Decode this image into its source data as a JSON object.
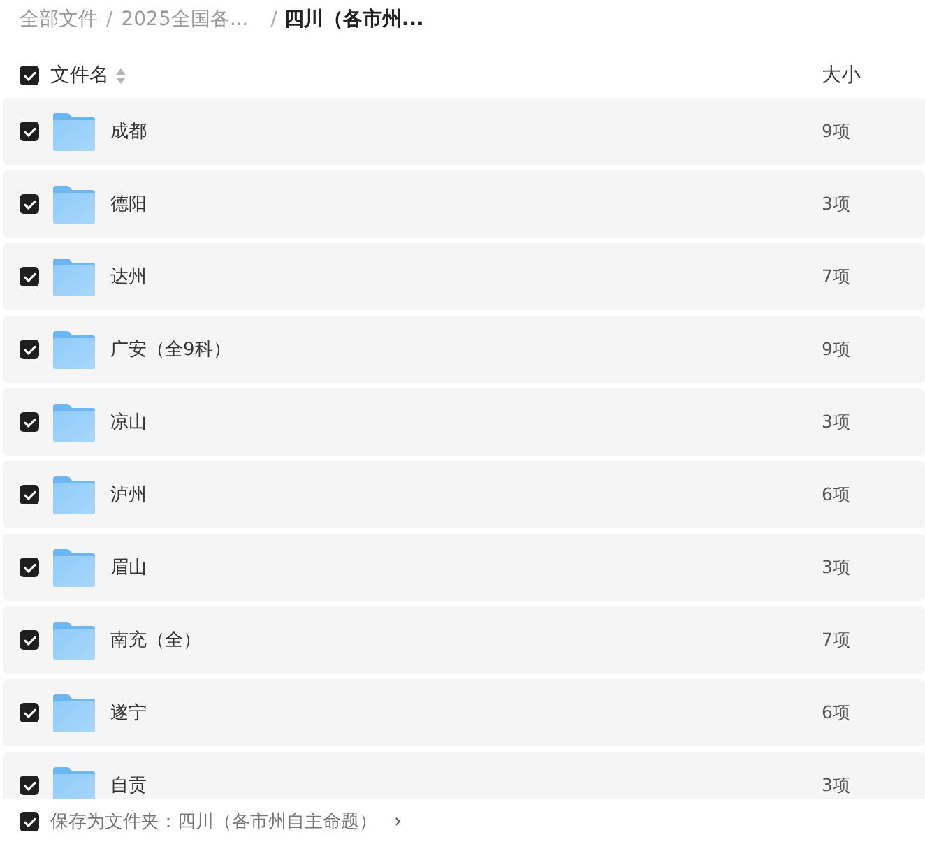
{
  "breadcrumb": {
    "separator": "/",
    "items": [
      {
        "label": "全部文件",
        "current": false
      },
      {
        "label": "2025全国各...",
        "current": false
      },
      {
        "label": "四川（各市州...",
        "current": true
      }
    ]
  },
  "header": {
    "checked": true,
    "name_column": "文件名",
    "size_column": "大小"
  },
  "rows": [
    {
      "name": "成都",
      "size": "9项",
      "checked": true
    },
    {
      "name": "德阳",
      "size": "3项",
      "checked": true
    },
    {
      "name": "达州",
      "size": "7项",
      "checked": true
    },
    {
      "name": "广安（全9科）",
      "size": "9项",
      "checked": true
    },
    {
      "name": "凉山",
      "size": "3项",
      "checked": true
    },
    {
      "name": "泸州",
      "size": "6项",
      "checked": true
    },
    {
      "name": "眉山",
      "size": "3项",
      "checked": true
    },
    {
      "name": "南充（全）",
      "size": "7项",
      "checked": true
    },
    {
      "name": "遂宁",
      "size": "6项",
      "checked": true
    },
    {
      "name": "自贡",
      "size": "3项",
      "checked": true
    }
  ],
  "footer": {
    "checked": true,
    "label": "保存为文件夹：四川（各市州自主命题）",
    "chevron": "›"
  }
}
